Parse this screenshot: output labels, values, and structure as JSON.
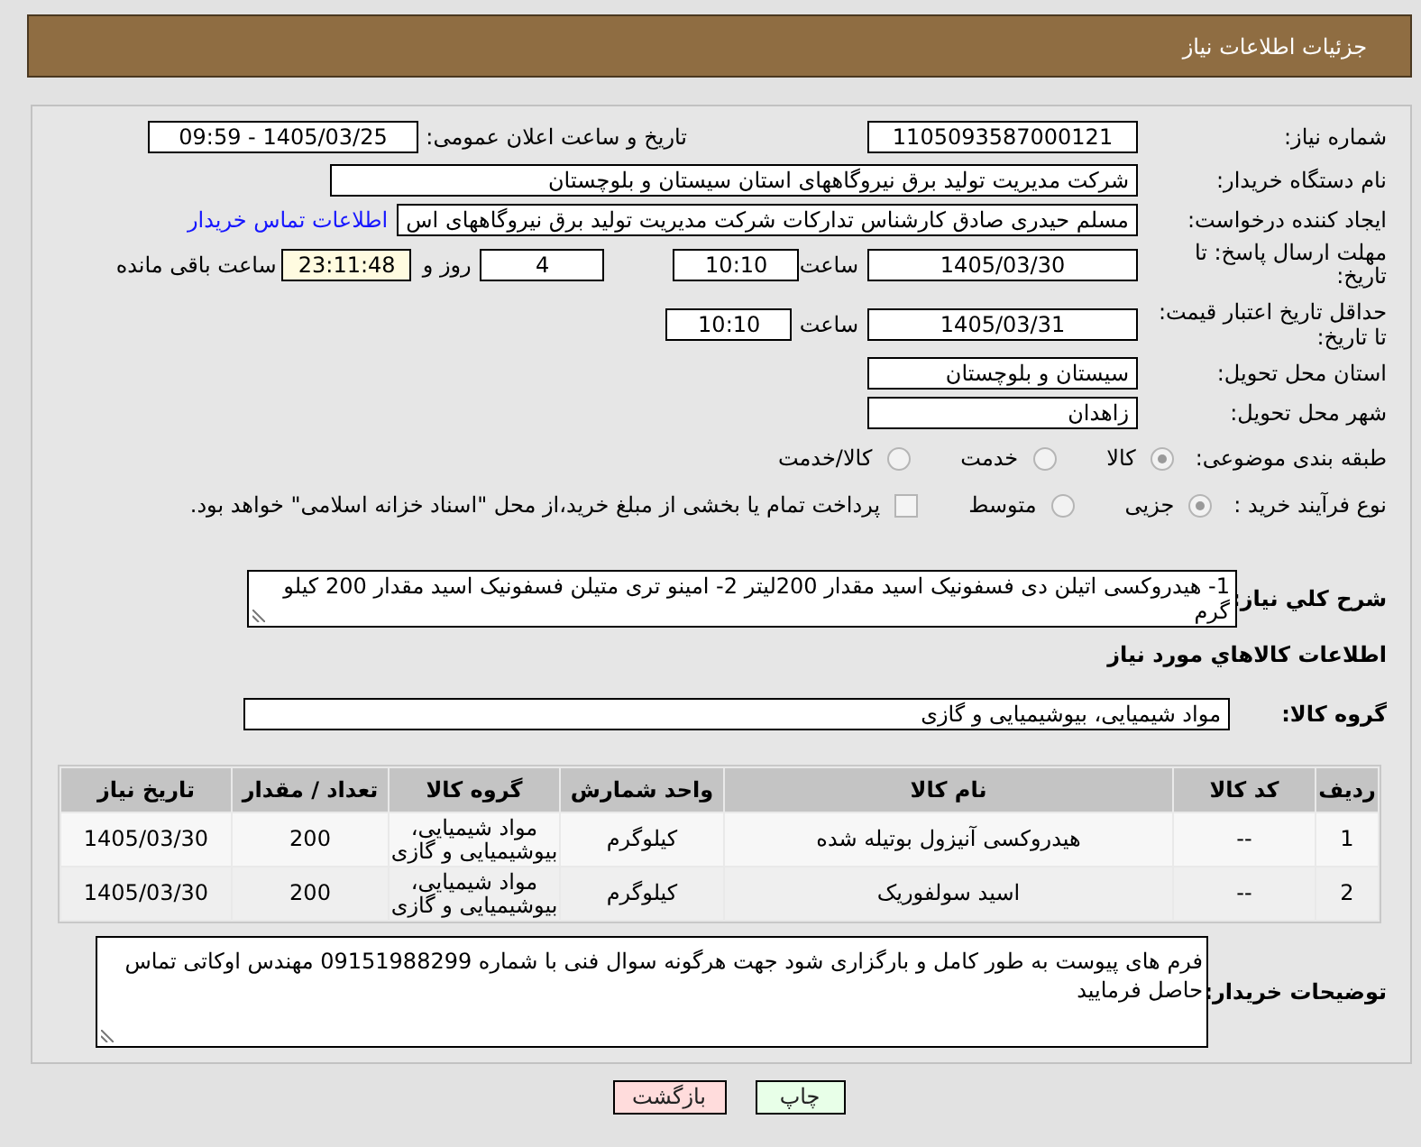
{
  "header": {
    "title": "جزئیات اطلاعات نیاز"
  },
  "form": {
    "need_number": {
      "label": "شماره نیاز:",
      "value": "1105093587000121"
    },
    "announcement": {
      "label": "تاریخ و ساعت اعلان عمومی:",
      "value": "1405/03/25 - 09:59"
    },
    "buyer_org": {
      "label": "نام دستگاه خریدار:",
      "value": "شرکت مدیریت تولید برق نیروگاههای استان سیستان و بلوچستان"
    },
    "requester": {
      "label": "ایجاد کننده درخواست:",
      "value": "مسلم حیدری صادق کارشناس تدارکات شرکت مدیریت تولید برق نیروگاههای اس",
      "link": "اطلاعات تماس خریدار"
    },
    "reply_deadline": {
      "label": "مهلت ارسال پاسخ: تا تاریخ:",
      "date": "1405/03/30",
      "time_label": "ساعت",
      "time": "10:10",
      "days": "4",
      "days_label": "روز و",
      "remaining": "23:11:48",
      "remaining_label": "ساعت باقی مانده"
    },
    "price_validity": {
      "label": "حداقل تاریخ اعتبار قیمت: تا تاریخ:",
      "date": "1405/03/31",
      "time_label": "ساعت",
      "time": "10:10"
    },
    "delivery_province": {
      "label": "استان محل تحویل:",
      "value": "سیستان و بلوچستان"
    },
    "delivery_city": {
      "label": "شهر محل تحویل:",
      "value": "زاهدان"
    },
    "category": {
      "label": "طبقه بندی موضوعی:",
      "options": [
        {
          "label": "کالا",
          "selected": true
        },
        {
          "label": "خدمت",
          "selected": false
        },
        {
          "label": "کالا/خدمت",
          "selected": false
        }
      ]
    },
    "purchase_process": {
      "label": "نوع فرآیند خرید :",
      "options": [
        {
          "label": "جزیی",
          "selected": true
        },
        {
          "label": "متوسط",
          "selected": false
        }
      ],
      "treasury_payment": {
        "label": "پرداخت تمام یا بخشی از مبلغ خرید،از محل \"اسناد خزانه اسلامی\" خواهد بود.",
        "checked": false
      }
    },
    "description": {
      "label": "شرح کلي نياز:",
      "value": "1- هیدروکسی اتیلن دی فسفونیک اسید  مقدار  200لیتر  2-  امینو تری متیلن فسفونیک اسید مقدار  200 کیلو گرم"
    }
  },
  "goods": {
    "title": "اطلاعات کالاهاي مورد نياز",
    "group": {
      "label": "گروه کالا:",
      "value": "مواد شیمیایی، بیوشیمیایی و  گازی"
    },
    "table": {
      "columns": [
        "ردیف",
        "کد کالا",
        "نام کالا",
        "واحد شمارش",
        "گروه کالا",
        "تعداد / مقدار",
        "تاریخ نیاز"
      ],
      "rows": [
        [
          "1",
          "--",
          "هیدروکسی آنیزول بوتیله شده",
          "کیلوگرم",
          "مواد شیمیایی، بیوشیمیایی و گازی",
          "200",
          "1405/03/30"
        ],
        [
          "2",
          "--",
          "اسید سولفوریک",
          "کیلوگرم",
          "مواد شیمیایی، بیوشیمیایی و گازی",
          "200",
          "1405/03/30"
        ]
      ]
    }
  },
  "buyer_notes": {
    "label": "توضیحات خریدار:",
    "value": "فرم های پیوست به طور کامل و بارگزاری شود جهت هرگونه سوال فنی با شماره 09151988299 مهندس اوکاتی تماس حاصل فرمایید"
  },
  "buttons": [
    {
      "label": "چاپ",
      "kind": "print"
    },
    {
      "label": "بازگشت",
      "kind": "back"
    }
  ]
}
